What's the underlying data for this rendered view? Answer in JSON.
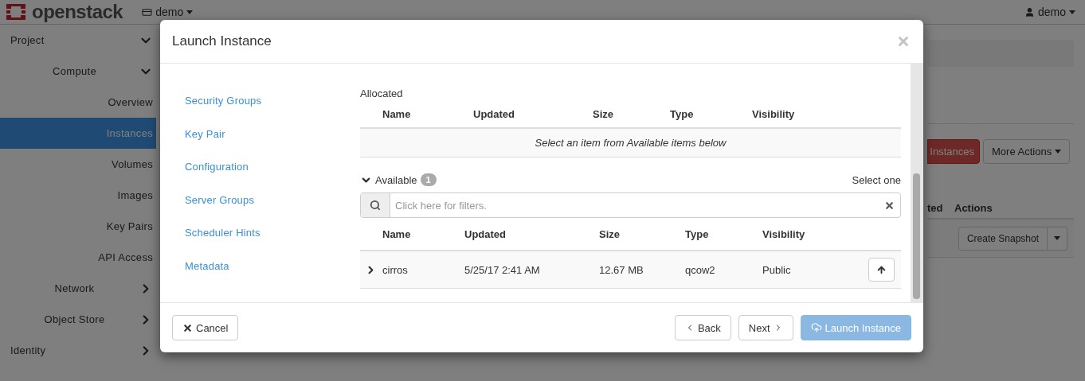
{
  "topbar": {
    "logo": "openstack",
    "project_menu": "demo",
    "user_menu": "demo"
  },
  "sidebar": {
    "items": [
      {
        "label": "Project",
        "expanded": true,
        "children": [
          {
            "label": "Compute",
            "expanded": true,
            "children": [
              {
                "label": "Overview",
                "selected": false
              },
              {
                "label": "Instances",
                "selected": true
              },
              {
                "label": "Volumes",
                "selected": false
              },
              {
                "label": "Images",
                "selected": false
              },
              {
                "label": "Key Pairs",
                "selected": false
              },
              {
                "label": "API Access",
                "selected": false
              }
            ]
          },
          {
            "label": "Network",
            "expanded": false
          },
          {
            "label": "Object Store",
            "expanded": false
          }
        ]
      },
      {
        "label": "Identity",
        "expanded": false
      }
    ]
  },
  "page": {
    "primary_button": "Instances",
    "actions_button": "More Actions",
    "table": {
      "columns": [
        "ted",
        "Actions"
      ],
      "row_action": "Create Snapshot"
    }
  },
  "modal": {
    "title": "Launch Instance",
    "steps": [
      {
        "label": "Security Groups"
      },
      {
        "label": "Key Pair"
      },
      {
        "label": "Configuration"
      },
      {
        "label": "Server Groups"
      },
      {
        "label": "Scheduler Hints"
      },
      {
        "label": "Metadata"
      }
    ],
    "allocated": {
      "label": "Allocated",
      "columns": [
        "Name",
        "Updated",
        "Size",
        "Type",
        "Visibility"
      ],
      "empty_message": "Select an item from Available items below"
    },
    "available": {
      "label": "Available",
      "expanded": true,
      "count": "1",
      "hint": "Select one",
      "filter": {
        "placeholder": "Click here for filters."
      },
      "columns": [
        "Name",
        "Updated",
        "Size",
        "Type",
        "Visibility"
      ],
      "rows": [
        {
          "cells": [
            "cirros",
            "5/25/17 2:41 AM",
            "12.67 MB",
            "qcow2",
            "Public"
          ],
          "expanded": false
        }
      ]
    },
    "footer": {
      "cancel": "Cancel",
      "back": "Back",
      "next": "Next",
      "launch": {
        "label": "Launch Instance",
        "disabled": true
      }
    }
  }
}
